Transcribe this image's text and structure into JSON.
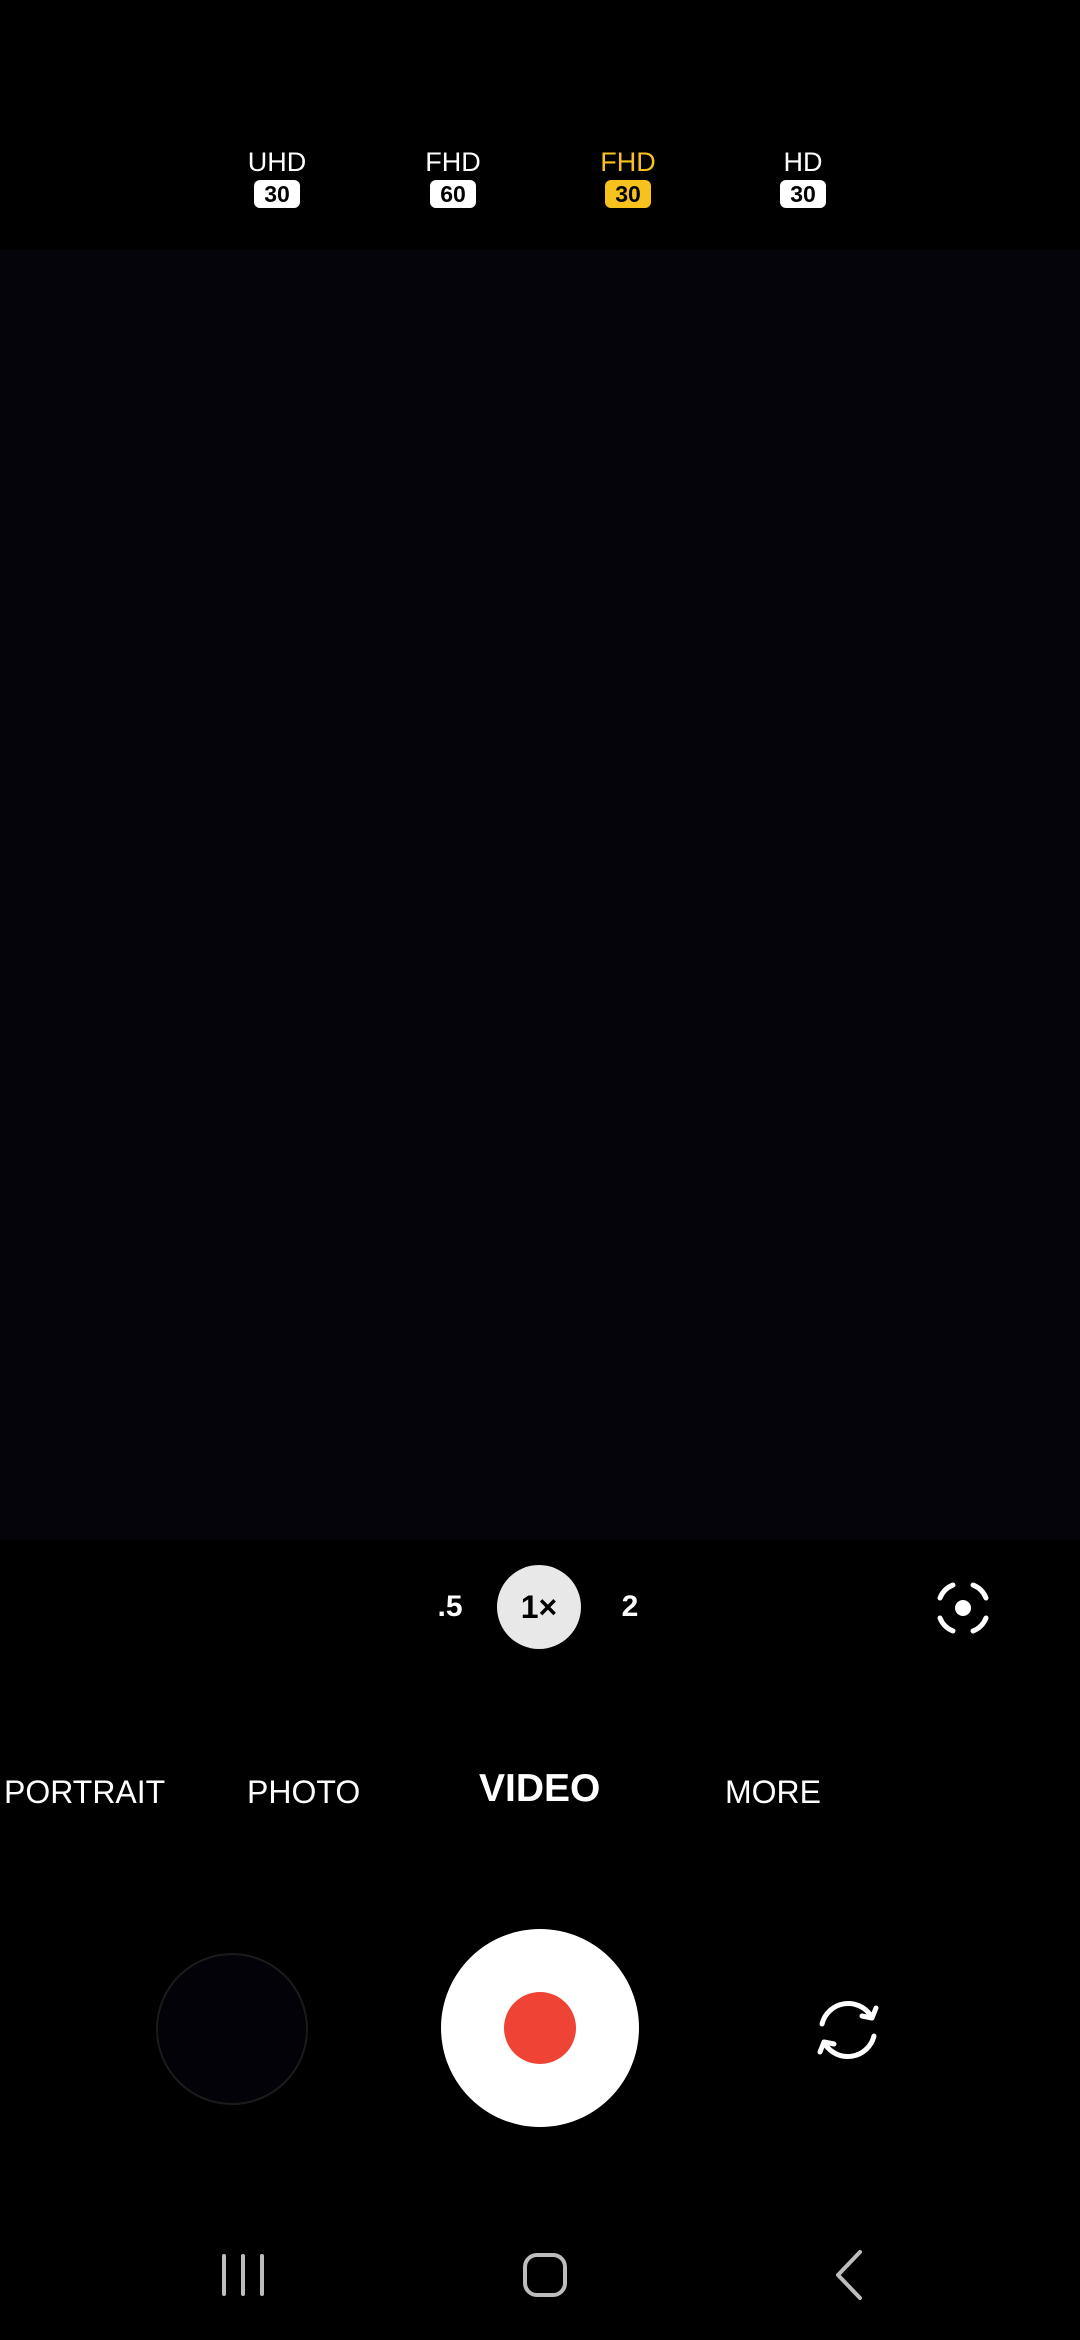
{
  "resolution_options": [
    {
      "label": "UHD",
      "fps": "30",
      "selected": false
    },
    {
      "label": "FHD",
      "fps": "60",
      "selected": false
    },
    {
      "label": "FHD",
      "fps": "30",
      "selected": true
    },
    {
      "label": "HD",
      "fps": "30",
      "selected": false
    }
  ],
  "zoom": {
    "wide": ".5",
    "current": "1×",
    "tele": "2"
  },
  "modes": {
    "portrait": "PORTRAIT",
    "photo": "PHOTO",
    "video": "VIDEO",
    "more": "MORE",
    "active": "VIDEO"
  },
  "icons": {
    "focus": "focus-target-icon",
    "flip": "flip-camera-icon",
    "record": "record-icon",
    "nav_recents": "recents-icon",
    "nav_home": "home-icon",
    "nav_back": "back-icon"
  },
  "colors": {
    "selected_accent": "#f7c21d",
    "record_red": "#ee4335",
    "background": "#000000"
  }
}
